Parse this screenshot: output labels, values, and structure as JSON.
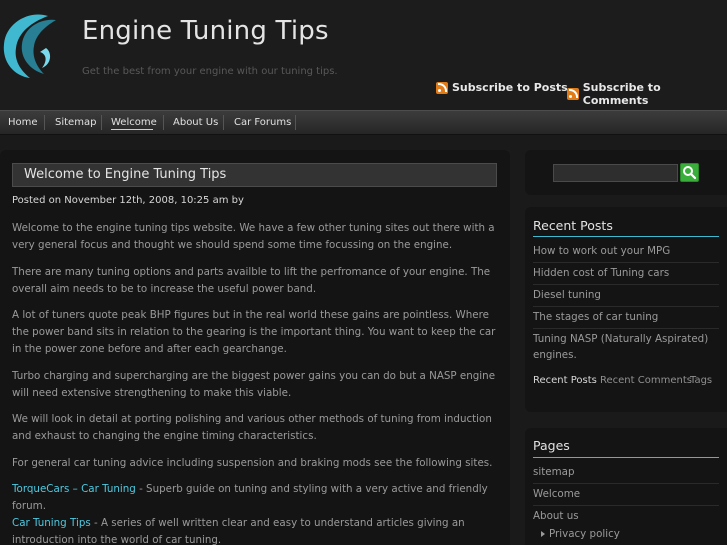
{
  "header": {
    "title": "Engine Tuning Tips",
    "description": "Get the best from your engine with our tuning tips.",
    "subscribe_posts": "Subscribe to Posts",
    "subscribe_comments": "Subscribe to Comments"
  },
  "nav": {
    "items": [
      "Home",
      "Sitemap",
      "Welcome",
      "About Us",
      "Car Forums"
    ],
    "active": "Welcome"
  },
  "post": {
    "title": "Welcome to Engine Tuning Tips",
    "meta": "Posted on November 12th, 2008, 10:25 am by",
    "paragraphs": [
      "Welcome to the engine tuning tips website. We have a few other tuning sites out there with a very general focus and thought we should spend some time focussing on the engine.",
      "There are many tuning options and parts availble to lift the perfromance of your engine. The overall aim needs to be to increase the useful power band.",
      "A lot of tuners quote peak BHP figures but in the real world these gains are pointless. Where the power band sits in relation to the gearing is the important thing. You want to keep the car in the power zone before and after each gearchange.",
      "Turbo charging and supercharging are the biggest power gains you can do but a NASP engine will need extensive strengthening to make this viable.",
      "We will look in detail at porting polishing and various other methods of tuning from induction and exhaust to changing the engine timing characteristics.",
      "For general car tuning advice including suspension and braking mods see the following sites."
    ],
    "links": [
      {
        "label": "TorqueCars – Car Tuning",
        "text": " - Superb guide on tuning and styling with a very active and friendly forum."
      },
      {
        "label": "Car Tuning Tips",
        "text": " - A series of well written clear and easy to understand articles giving an introduction into the world of car tuning."
      }
    ]
  },
  "sidebar": {
    "search_value": "",
    "recent_heading": "Recent Posts",
    "recent_posts": [
      "How to work out your MPG",
      "Hidden cost of Tuning cars",
      "Diesel tuning",
      "The stages of car tuning",
      "Tuning NASP (Naturally Aspirated) engines."
    ],
    "tabs": [
      "Recent Posts",
      "Recent Comments",
      "Tags"
    ],
    "pages_heading": "Pages",
    "pages": [
      "sitemap",
      "Welcome",
      "About us"
    ],
    "subpages": [
      "Privacy policy"
    ]
  },
  "colors": {
    "accent": "#3fb8d0",
    "link": "#4ec9e0",
    "background": "#1a1a1a"
  }
}
